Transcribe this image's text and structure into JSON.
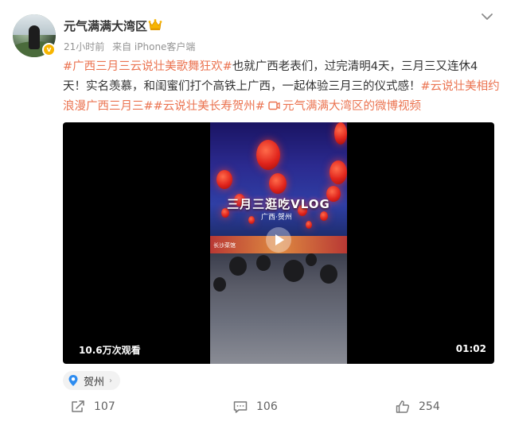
{
  "post": {
    "username": "元气满满大湾区",
    "verified_badge": "v",
    "time": "21小时前",
    "source": "来自 iPhone客户端",
    "text_parts": {
      "tag1": "#广西三月三云说壮美歌舞狂欢#",
      "body1": "也就广西老表们，过完清明4天，三月三又连休4天！实名羡慕，和闺蜜们打个高铁上广西，一起体验三月三的仪式感！",
      "tag2": "#云说壮美相约浪漫广西三月三#",
      "tag3": "#云说壮美长寿贺州#",
      "link_text": "元气满满大湾区的微博视频"
    }
  },
  "video": {
    "overlay_title": "三月三逛吃VLOG",
    "overlay_subtitle": "广西·贺州",
    "shop_sign": "长沙菜馆",
    "views": "10.6万次观看",
    "duration": "01:02"
  },
  "location": {
    "name": "贺州",
    "arrow": "›"
  },
  "actions": {
    "repost_count": "107",
    "comment_count": "106",
    "like_count": "254"
  },
  "icons": {
    "crown": "crown-icon",
    "chevron": "chevron-down-icon",
    "pin": "location-pin-icon",
    "repost": "repost-icon",
    "comment": "comment-icon",
    "like": "like-icon",
    "video_link": "video-link-icon"
  },
  "colors": {
    "accent": "#eb7350",
    "meta": "#939393",
    "action_text": "#636363",
    "verified": "#f7b500",
    "location_pin": "#2d8cf0"
  }
}
